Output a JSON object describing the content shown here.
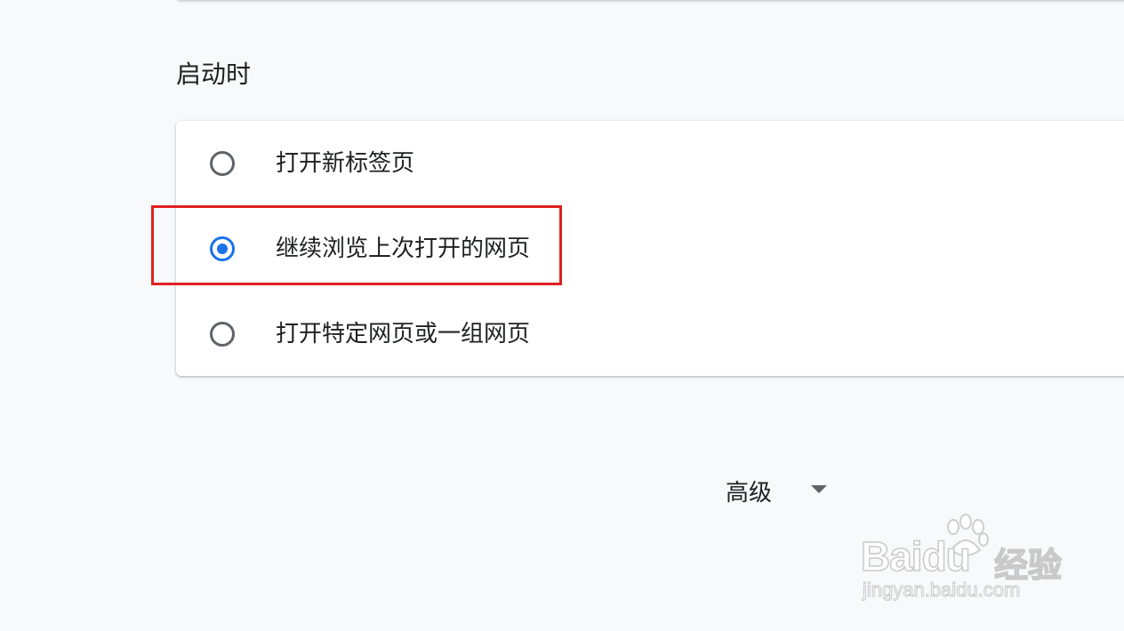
{
  "section": {
    "title": "启动时"
  },
  "startup_options": [
    {
      "label": "打开新标签页",
      "checked": false
    },
    {
      "label": "继续浏览上次打开的网页",
      "checked": true
    },
    {
      "label": "打开特定网页或一组网页",
      "checked": false
    }
  ],
  "advanced": {
    "label": "高级"
  },
  "watermark": {
    "brand": "Baidu",
    "suffix": "经验",
    "url": "jingyan.baidu.com"
  },
  "colors": {
    "accent": "#1a73e8",
    "highlight": "#e02020",
    "background": "#f8f9fa"
  }
}
